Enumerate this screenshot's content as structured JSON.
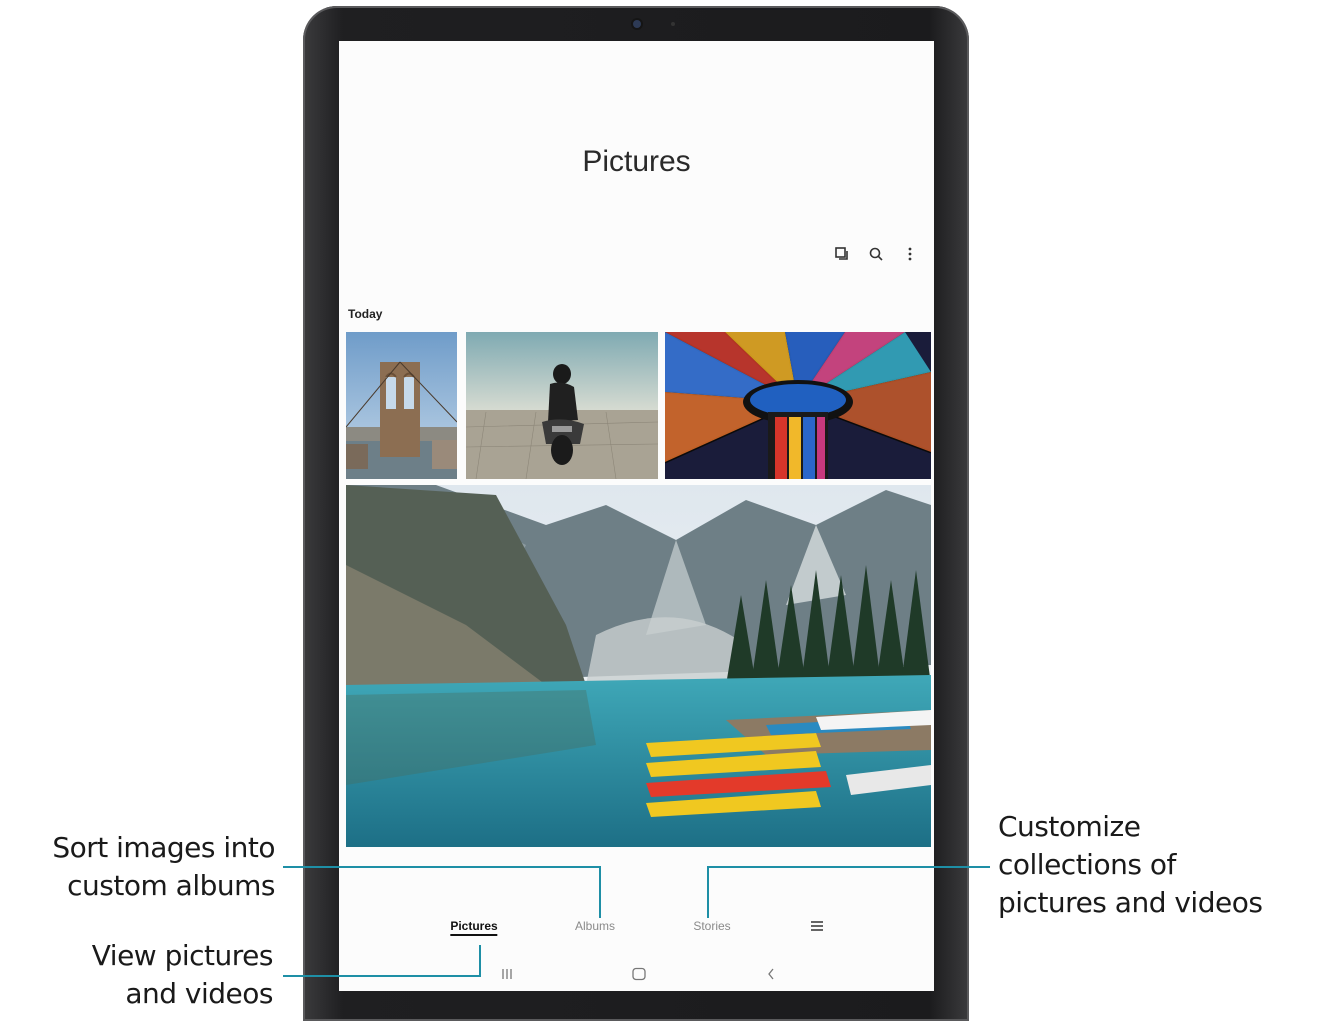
{
  "app": {
    "title": "Pictures"
  },
  "toolbar": {
    "icons": [
      "select-icon",
      "search-icon",
      "more-options-icon"
    ]
  },
  "section": {
    "today_label": "Today"
  },
  "gallery": {
    "items": [
      {
        "subject": "bridge-photo"
      },
      {
        "subject": "motorcycle-photo"
      },
      {
        "subject": "stained-glass-photo"
      },
      {
        "subject": "lake-mountains-photo"
      }
    ]
  },
  "bottom_nav": {
    "pictures_label": "Pictures",
    "albums_label": "Albums",
    "stories_label": "Stories",
    "menu_icon": "menu-icon"
  },
  "system_nav": {
    "icons": [
      "recents-icon",
      "home-icon",
      "back-icon"
    ]
  },
  "callouts": {
    "albums_line1": "Sort images into",
    "albums_line2": "custom albums",
    "pictures_line1": "View pictures",
    "pictures_line2": "and videos",
    "stories_line1": "Customize",
    "stories_line2": "collections of",
    "stories_line3": "pictures and videos"
  },
  "colors": {
    "callout_line": "#1e8fa6",
    "device_frame": "#1b1b1d"
  }
}
